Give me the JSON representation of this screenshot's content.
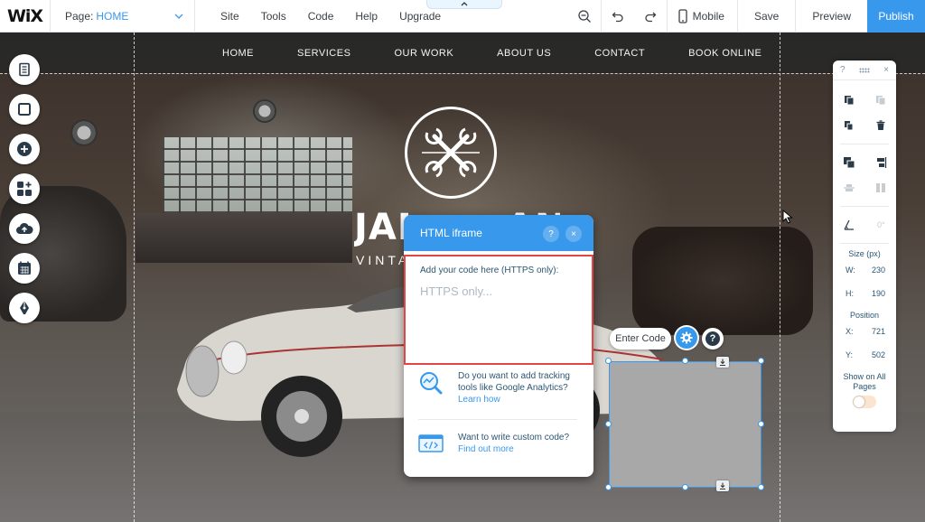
{
  "topbar": {
    "logo": "WiX",
    "page_label": "Page:",
    "page_value": "HOME",
    "menu": [
      "Site",
      "Tools",
      "Code",
      "Help",
      "Upgrade"
    ],
    "mobile_label": "Mobile",
    "save_label": "Save",
    "preview_label": "Preview",
    "publish_label": "Publish"
  },
  "site": {
    "nav": [
      "HOME",
      "SERVICES",
      "OUR WORK",
      "ABOUT US",
      "CONTACT",
      "BOOK ONLINE"
    ],
    "title_left": "JADE",
    "title_right": "ANDY",
    "subtitle": "VINTA"
  },
  "tool_panel": {
    "help": "?",
    "close": "×",
    "size_label": "Size (px)",
    "w_label": "W:",
    "w_value": "230",
    "h_label": "H:",
    "h_value": "190",
    "position_label": "Position",
    "x_label": "X:",
    "x_value": "721",
    "y_label": "Y:",
    "y_value": "502",
    "rotate_value": "0°",
    "show_all_label": "Show on All Pages",
    "show_all_on": false
  },
  "element": {
    "enter_code_label": "Enter Code",
    "help": "?"
  },
  "dialog": {
    "title": "HTML iframe",
    "help": "?",
    "close": "×",
    "code_label": "Add your code here (HTTPS only):",
    "code_placeholder": "HTTPS only...",
    "item1_text": "Do you want to add tracking tools like Google Analytics?",
    "item1_link": "Learn how",
    "item2_text": "Want to write custom code?",
    "item2_link": "Find out more"
  },
  "colors": {
    "accent": "#3899ec",
    "highlight_border": "#e04646"
  }
}
